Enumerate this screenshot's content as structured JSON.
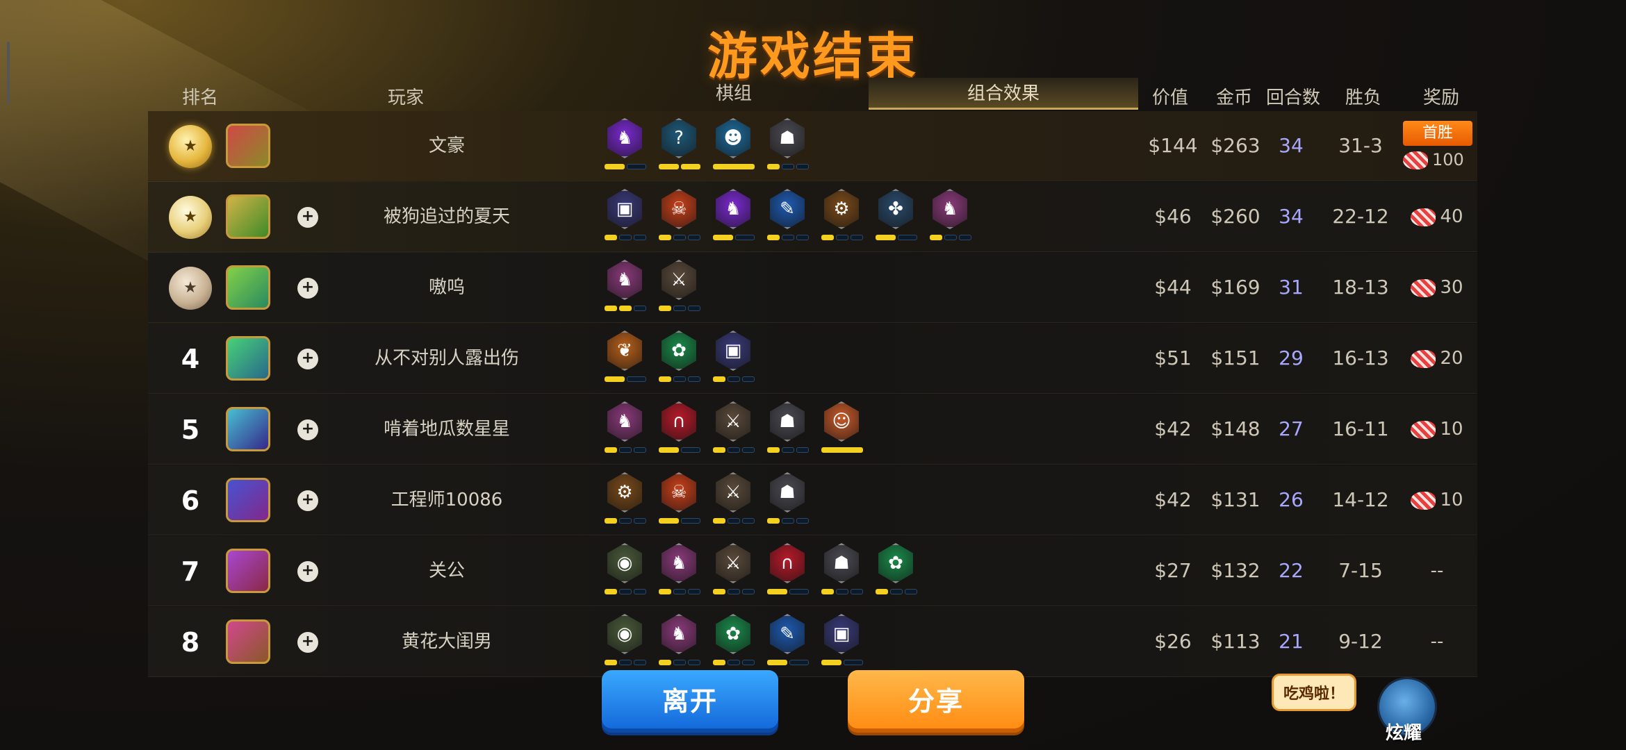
{
  "title": "游戏结束",
  "headers": {
    "rank": "排名",
    "player": "玩家",
    "value": "价值",
    "gold": "金币",
    "rounds": "回合数",
    "record": "胜负",
    "reward": "奖励"
  },
  "tabs": [
    {
      "label": "棋组",
      "active": false
    },
    {
      "label": "组合效果",
      "active": true
    }
  ],
  "colors": {
    "title": "#ff9a1f",
    "leave_button": "#1f86f0",
    "share_button": "#ff9a20",
    "rounds_text": "#a8a8ff"
  },
  "rows": [
    {
      "rank": "",
      "medal": "gold",
      "name": "文豪",
      "value": "$144",
      "gold": "$263",
      "rounds": "34",
      "record": "31-3",
      "reward": "100",
      "first_win": "首胜",
      "traits": [
        {
          "icon": "dragon-icon",
          "color": "#7a2ad0",
          "on": 1,
          "total": 2
        },
        {
          "icon": "mystic-icon",
          "color": "#1e5a7a",
          "on": 2,
          "total": 2
        },
        {
          "icon": "demon-icon",
          "color": "#1e6a9a",
          "on": 1,
          "total": 1
        },
        {
          "icon": "knight-icon",
          "color": "#4a4a52",
          "on": 1,
          "total": 3
        }
      ]
    },
    {
      "rank": "",
      "medal": "silver",
      "name": "被狗追过的夏天",
      "value": "$46",
      "gold": "$260",
      "rounds": "34",
      "record": "22-12",
      "reward": "40",
      "traits": [
        {
          "icon": "mech-icon",
          "color": "#3a3a7a",
          "on": 1,
          "total": 3
        },
        {
          "icon": "orc-icon",
          "color": "#c8401a",
          "on": 1,
          "total": 3
        },
        {
          "icon": "dragon-icon",
          "color": "#7a2ad0",
          "on": 1,
          "total": 2
        },
        {
          "icon": "feather-icon",
          "color": "#1e5ab0",
          "on": 1,
          "total": 3
        },
        {
          "icon": "gear-icon",
          "color": "#7a4a1a",
          "on": 1,
          "total": 3
        },
        {
          "icon": "warrior-icon",
          "color": "#2a4a6a",
          "on": 1,
          "total": 2
        },
        {
          "icon": "horse-icon",
          "color": "#8a3a7a",
          "on": 1,
          "total": 3
        }
      ]
    },
    {
      "rank": "",
      "medal": "bronze",
      "name": "嗷呜",
      "value": "$44",
      "gold": "$169",
      "rounds": "31",
      "record": "18-13",
      "reward": "30",
      "traits": [
        {
          "icon": "horse-icon",
          "color": "#8a3a7a",
          "on": 2,
          "total": 3
        },
        {
          "icon": "axe-icon",
          "color": "#5a4a3a",
          "on": 1,
          "total": 3
        }
      ]
    },
    {
      "rank": "4",
      "medal": "",
      "name": "从不对别人露出伤",
      "value": "$51",
      "gold": "$151",
      "rounds": "29",
      "record": "16-13",
      "reward": "20",
      "traits": [
        {
          "icon": "leaf-icon",
          "color": "#b8601a",
          "on": 1,
          "total": 2
        },
        {
          "icon": "paw-icon",
          "color": "#1a8a4a",
          "on": 1,
          "total": 3
        },
        {
          "icon": "mech-icon",
          "color": "#3a3a7a",
          "on": 1,
          "total": 3
        }
      ]
    },
    {
      "rank": "5",
      "medal": "",
      "name": "啃着地瓜数星星",
      "value": "$42",
      "gold": "$148",
      "rounds": "27",
      "record": "16-11",
      "reward": "10",
      "traits": [
        {
          "icon": "horse-icon",
          "color": "#8a3a7a",
          "on": 1,
          "total": 3
        },
        {
          "icon": "arch-icon",
          "color": "#b81a2a",
          "on": 1,
          "total": 2
        },
        {
          "icon": "axe-icon",
          "color": "#5a4a3a",
          "on": 1,
          "total": 3
        },
        {
          "icon": "knight-icon",
          "color": "#4a4a52",
          "on": 1,
          "total": 3
        },
        {
          "icon": "goblin-icon",
          "color": "#c85a2a",
          "on": 1,
          "total": 1
        }
      ]
    },
    {
      "rank": "6",
      "medal": "",
      "name": "工程师10086",
      "value": "$42",
      "gold": "$131",
      "rounds": "26",
      "record": "14-12",
      "reward": "10",
      "traits": [
        {
          "icon": "gear-icon",
          "color": "#7a4a1a",
          "on": 1,
          "total": 3
        },
        {
          "icon": "orc-icon",
          "color": "#c8401a",
          "on": 1,
          "total": 2
        },
        {
          "icon": "axe-icon",
          "color": "#5a4a3a",
          "on": 1,
          "total": 3
        },
        {
          "icon": "knight-icon",
          "color": "#4a4a52",
          "on": 1,
          "total": 3
        }
      ]
    },
    {
      "rank": "7",
      "medal": "",
      "name": "关公",
      "value": "$27",
      "gold": "$132",
      "rounds": "22",
      "record": "7-15",
      "reward": "--",
      "traits": [
        {
          "icon": "turtle-icon",
          "color": "#4a5a3a",
          "on": 1,
          "total": 3
        },
        {
          "icon": "horse-icon",
          "color": "#8a3a7a",
          "on": 1,
          "total": 3
        },
        {
          "icon": "axe-icon",
          "color": "#5a4a3a",
          "on": 1,
          "total": 3
        },
        {
          "icon": "arch-icon",
          "color": "#b81a2a",
          "on": 1,
          "total": 2
        },
        {
          "icon": "knight-icon",
          "color": "#4a4a52",
          "on": 1,
          "total": 3
        },
        {
          "icon": "paw-icon",
          "color": "#1a8a4a",
          "on": 1,
          "total": 3
        }
      ]
    },
    {
      "rank": "8",
      "medal": "",
      "name": "黄花大闺男",
      "value": "$26",
      "gold": "$113",
      "rounds": "21",
      "record": "9-12",
      "reward": "--",
      "traits": [
        {
          "icon": "turtle-icon",
          "color": "#4a5a3a",
          "on": 1,
          "total": 3
        },
        {
          "icon": "horse-icon",
          "color": "#8a3a7a",
          "on": 1,
          "total": 3
        },
        {
          "icon": "paw-icon",
          "color": "#1a8a4a",
          "on": 1,
          "total": 3
        },
        {
          "icon": "feather-icon",
          "color": "#1e5ab0",
          "on": 1,
          "total": 2
        },
        {
          "icon": "mech-icon",
          "color": "#3a3a7a",
          "on": 1,
          "total": 2
        }
      ]
    }
  ],
  "buttons": {
    "leave": "离开",
    "share": "分享"
  },
  "bubble": "吃鸡啦！",
  "mascot_label": "炫耀"
}
